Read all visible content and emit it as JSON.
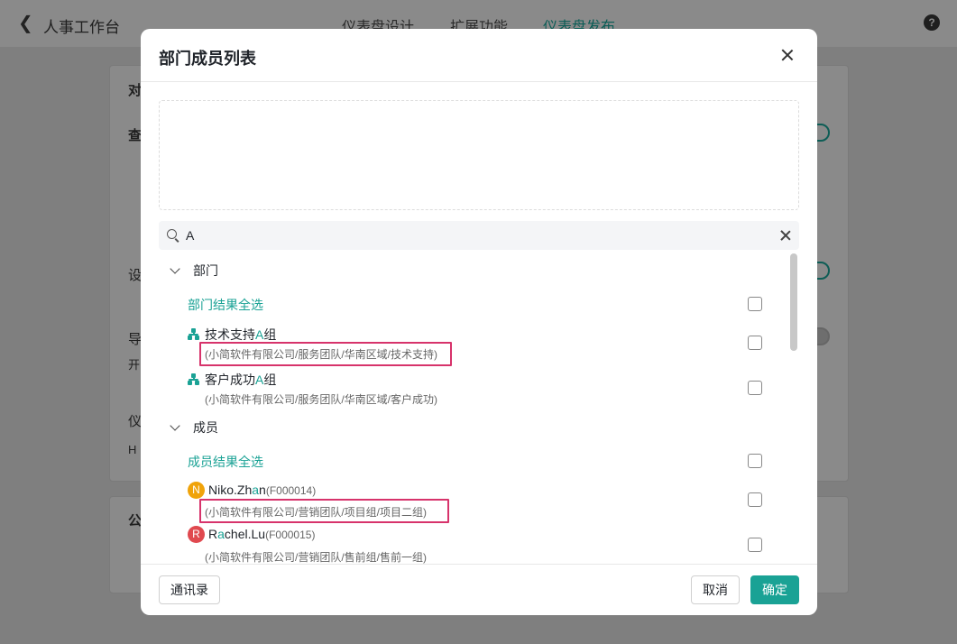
{
  "app": {
    "title": "人事工作台",
    "tabs": [
      "仪表盘设计",
      "扩展功能",
      "仪表盘发布"
    ],
    "active_tab": "仪表盘发布",
    "bg_labels": [
      "对",
      "查",
      "设",
      "导",
      "开",
      "仪",
      "H",
      "公"
    ]
  },
  "modal": {
    "title": "部门成员列表",
    "search": {
      "value": "A",
      "placeholder": ""
    },
    "dept_section": {
      "label": "部门",
      "select_all": "部门结果全选",
      "items": [
        {
          "name_pre": "技术支持",
          "name_hl": "A",
          "name_post": "组",
          "path": "(小简软件有限公司/服务团队/华南区域/技术支持)",
          "highlighted": true
        },
        {
          "name_pre": "客户成功",
          "name_hl": "A",
          "name_post": "组",
          "path": "(小简软件有限公司/服务团队/华南区域/客户成功)",
          "highlighted": false
        }
      ]
    },
    "member_section": {
      "label": "成员",
      "select_all": "成员结果全选",
      "items": [
        {
          "avatar": "N",
          "avatar_color": "#f0a30a",
          "name_pre": "Niko.Zh",
          "name_hl": "a",
          "name_post": "n",
          "code": "(F000014)",
          "path": "(小简软件有限公司/营销团队/项目组/项目二组)",
          "highlighted": true
        },
        {
          "avatar": "R",
          "avatar_color": "#e0494f",
          "name_pre": "R",
          "name_hl": "a",
          "name_post": "chel.Lu",
          "code": "(F000015)",
          "path": "(小简软件有限公司/营销团队/售前组/售前一组)",
          "highlighted": false
        }
      ]
    },
    "footer": {
      "contacts_label": "通讯录",
      "cancel_label": "取消",
      "confirm_label": "确定"
    }
  },
  "colors": {
    "accent": "#1aa295",
    "highlight_box": "#d7336b"
  }
}
